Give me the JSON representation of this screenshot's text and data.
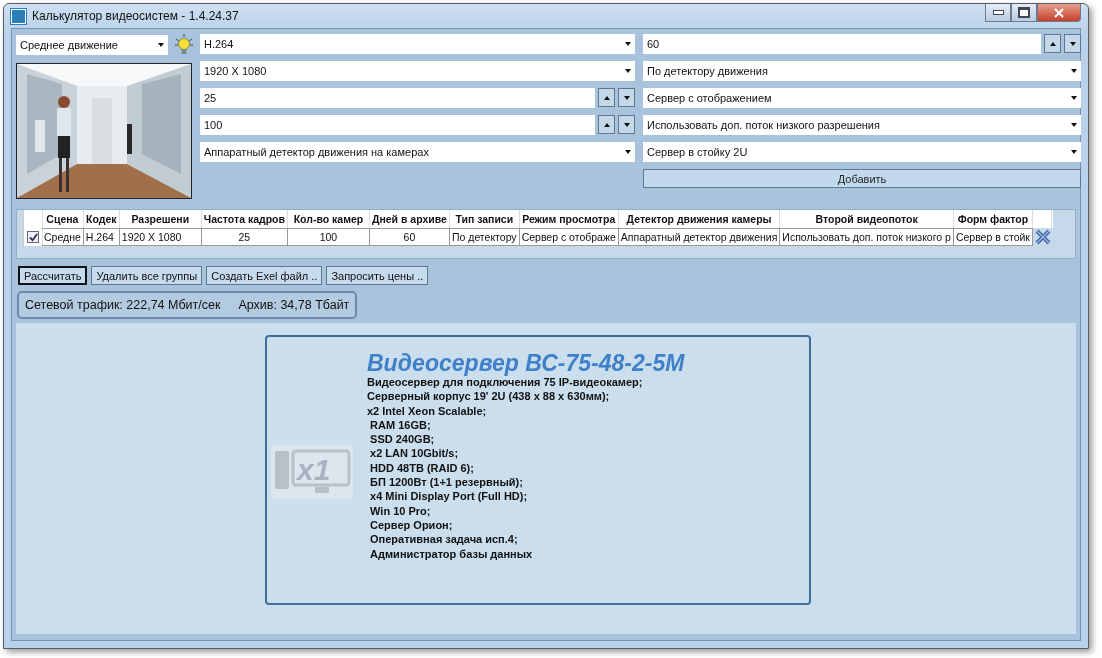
{
  "window": {
    "title": "Калькулятор видеосистем - 1.4.24.37"
  },
  "preset": {
    "value": "Среднее движение"
  },
  "fields_middle": [
    {
      "kind": "dropdown",
      "value": "H.264"
    },
    {
      "kind": "dropdown",
      "value": "1920 X 1080"
    },
    {
      "kind": "spinner",
      "value": "25"
    },
    {
      "kind": "spinner",
      "value": "100"
    },
    {
      "kind": "dropdown",
      "value": "Аппаратный детектор движения на камерах"
    }
  ],
  "fields_right": [
    {
      "kind": "spinner",
      "value": "60"
    },
    {
      "kind": "dropdown",
      "value": "По детектору движения"
    },
    {
      "kind": "dropdown",
      "value": "Сервер с отображением"
    },
    {
      "kind": "dropdown",
      "value": "Использовать доп. поток низкого разрешения"
    },
    {
      "kind": "dropdown",
      "value": "Сервер в стойку 2U"
    }
  ],
  "add_button": "Добавить",
  "table": {
    "columns": [
      "Сцена",
      "Кодек",
      "Разрешени",
      "Частота кадров",
      "Кол-во камер",
      "Дней в архиве",
      "Тип записи",
      "Режим просмотра",
      "Детектор движения камеры",
      "Второй видеопоток",
      "Форм фактор"
    ],
    "rows": [
      {
        "checked": true,
        "cells": [
          "Средне",
          "H.264",
          "1920 X 1080",
          "25",
          "100",
          "60",
          "По детектору",
          "Сервер с отображе",
          "Аппаратный детектор движения",
          "Использовать доп. поток низкого р",
          "Сервер в стойк"
        ]
      }
    ]
  },
  "buttons": [
    {
      "label": "Рассчитать",
      "focused": true
    },
    {
      "label": "Удалить все группы",
      "focused": false
    },
    {
      "label": "Создать Exel файл ..",
      "focused": false
    },
    {
      "label": "Запросить цены ..",
      "focused": false
    }
  ],
  "status": {
    "traffic": "Сетевой трафик: 222,74 Мбит/сек",
    "archive": "Архив: 34,78 Тбайт"
  },
  "result": {
    "title": "Видеосервер ВС-75-48-2-5М",
    "quantity": "x1",
    "lines": [
      "Видеосервер для подключения 75 IP-видеокамер;",
      "Серверный корпус 19' 2U (438 x 88 x 630мм);",
      "x2 Intel Xeon Scalable;",
      " RAM 16GB;",
      " SSD 240GB;",
      " x2 LAN 10Gbit/s;",
      " HDD 48TB (RAID 6);",
      " БП 1200Вт (1+1 резервный);",
      " x4 Mini Display Port (Full HD);",
      " Win 10 Pro;",
      " Сервер Орион;",
      " Оперативная задача исп.4;",
      " Администратор базы данных"
    ]
  }
}
